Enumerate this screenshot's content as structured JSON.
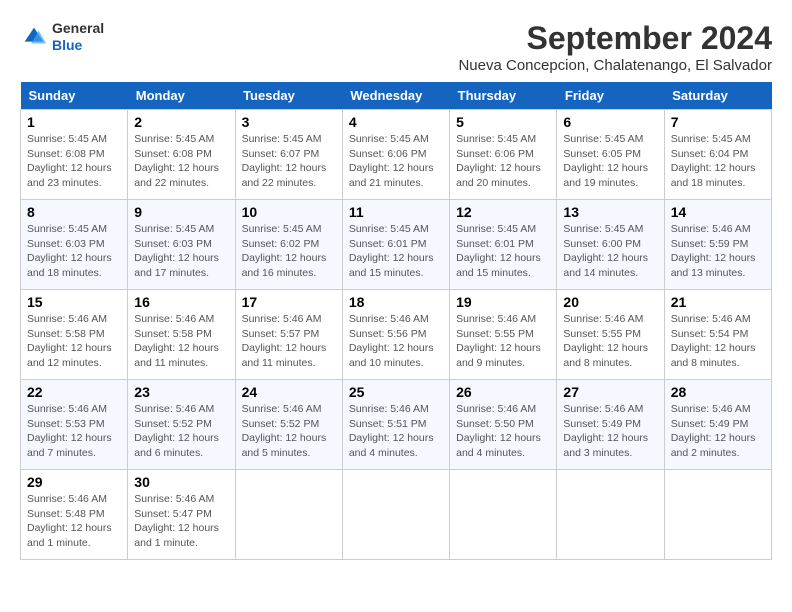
{
  "header": {
    "logo_general": "General",
    "logo_blue": "Blue",
    "month_title": "September 2024",
    "location": "Nueva Concepcion, Chalatenango, El Salvador"
  },
  "calendar": {
    "days_of_week": [
      "Sunday",
      "Monday",
      "Tuesday",
      "Wednesday",
      "Thursday",
      "Friday",
      "Saturday"
    ],
    "weeks": [
      [
        null,
        null,
        null,
        null,
        null,
        null,
        null
      ]
    ],
    "cells": [
      {
        "day": 1,
        "col": 0,
        "sunrise": "5:45 AM",
        "sunset": "6:08 PM",
        "daylight": "12 hours and 23 minutes."
      },
      {
        "day": 2,
        "col": 1,
        "sunrise": "5:45 AM",
        "sunset": "6:08 PM",
        "daylight": "12 hours and 22 minutes."
      },
      {
        "day": 3,
        "col": 2,
        "sunrise": "5:45 AM",
        "sunset": "6:07 PM",
        "daylight": "12 hours and 22 minutes."
      },
      {
        "day": 4,
        "col": 3,
        "sunrise": "5:45 AM",
        "sunset": "6:06 PM",
        "daylight": "12 hours and 21 minutes."
      },
      {
        "day": 5,
        "col": 4,
        "sunrise": "5:45 AM",
        "sunset": "6:06 PM",
        "daylight": "12 hours and 20 minutes."
      },
      {
        "day": 6,
        "col": 5,
        "sunrise": "5:45 AM",
        "sunset": "6:05 PM",
        "daylight": "12 hours and 19 minutes."
      },
      {
        "day": 7,
        "col": 6,
        "sunrise": "5:45 AM",
        "sunset": "6:04 PM",
        "daylight": "12 hours and 18 minutes."
      },
      {
        "day": 8,
        "col": 0,
        "sunrise": "5:45 AM",
        "sunset": "6:03 PM",
        "daylight": "12 hours and 18 minutes."
      },
      {
        "day": 9,
        "col": 1,
        "sunrise": "5:45 AM",
        "sunset": "6:03 PM",
        "daylight": "12 hours and 17 minutes."
      },
      {
        "day": 10,
        "col": 2,
        "sunrise": "5:45 AM",
        "sunset": "6:02 PM",
        "daylight": "12 hours and 16 minutes."
      },
      {
        "day": 11,
        "col": 3,
        "sunrise": "5:45 AM",
        "sunset": "6:01 PM",
        "daylight": "12 hours and 15 minutes."
      },
      {
        "day": 12,
        "col": 4,
        "sunrise": "5:45 AM",
        "sunset": "6:01 PM",
        "daylight": "12 hours and 15 minutes."
      },
      {
        "day": 13,
        "col": 5,
        "sunrise": "5:45 AM",
        "sunset": "6:00 PM",
        "daylight": "12 hours and 14 minutes."
      },
      {
        "day": 14,
        "col": 6,
        "sunrise": "5:46 AM",
        "sunset": "5:59 PM",
        "daylight": "12 hours and 13 minutes."
      },
      {
        "day": 15,
        "col": 0,
        "sunrise": "5:46 AM",
        "sunset": "5:58 PM",
        "daylight": "12 hours and 12 minutes."
      },
      {
        "day": 16,
        "col": 1,
        "sunrise": "5:46 AM",
        "sunset": "5:58 PM",
        "daylight": "12 hours and 11 minutes."
      },
      {
        "day": 17,
        "col": 2,
        "sunrise": "5:46 AM",
        "sunset": "5:57 PM",
        "daylight": "12 hours and 11 minutes."
      },
      {
        "day": 18,
        "col": 3,
        "sunrise": "5:46 AM",
        "sunset": "5:56 PM",
        "daylight": "12 hours and 10 minutes."
      },
      {
        "day": 19,
        "col": 4,
        "sunrise": "5:46 AM",
        "sunset": "5:55 PM",
        "daylight": "12 hours and 9 minutes."
      },
      {
        "day": 20,
        "col": 5,
        "sunrise": "5:46 AM",
        "sunset": "5:55 PM",
        "daylight": "12 hours and 8 minutes."
      },
      {
        "day": 21,
        "col": 6,
        "sunrise": "5:46 AM",
        "sunset": "5:54 PM",
        "daylight": "12 hours and 8 minutes."
      },
      {
        "day": 22,
        "col": 0,
        "sunrise": "5:46 AM",
        "sunset": "5:53 PM",
        "daylight": "12 hours and 7 minutes."
      },
      {
        "day": 23,
        "col": 1,
        "sunrise": "5:46 AM",
        "sunset": "5:52 PM",
        "daylight": "12 hours and 6 minutes."
      },
      {
        "day": 24,
        "col": 2,
        "sunrise": "5:46 AM",
        "sunset": "5:52 PM",
        "daylight": "12 hours and 5 minutes."
      },
      {
        "day": 25,
        "col": 3,
        "sunrise": "5:46 AM",
        "sunset": "5:51 PM",
        "daylight": "12 hours and 4 minutes."
      },
      {
        "day": 26,
        "col": 4,
        "sunrise": "5:46 AM",
        "sunset": "5:50 PM",
        "daylight": "12 hours and 4 minutes."
      },
      {
        "day": 27,
        "col": 5,
        "sunrise": "5:46 AM",
        "sunset": "5:49 PM",
        "daylight": "12 hours and 3 minutes."
      },
      {
        "day": 28,
        "col": 6,
        "sunrise": "5:46 AM",
        "sunset": "5:49 PM",
        "daylight": "12 hours and 2 minutes."
      },
      {
        "day": 29,
        "col": 0,
        "sunrise": "5:46 AM",
        "sunset": "5:48 PM",
        "daylight": "12 hours and 1 minute."
      },
      {
        "day": 30,
        "col": 1,
        "sunrise": "5:46 AM",
        "sunset": "5:47 PM",
        "daylight": "12 hours and 1 minute."
      }
    ]
  }
}
